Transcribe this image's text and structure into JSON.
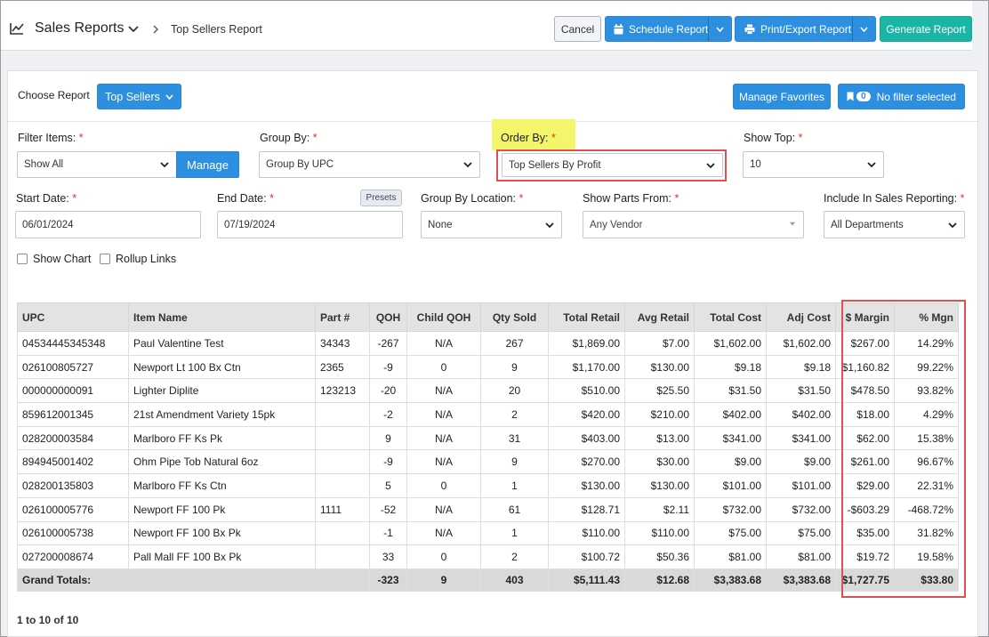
{
  "header": {
    "app_title": "Sales Reports",
    "breadcrumb": "Top Sellers Report",
    "cancel_label": "Cancel",
    "schedule_label": "Schedule Report",
    "print_label": "Print/Export Report",
    "generate_label": "Generate Report"
  },
  "report_bar": {
    "choose_label": "Choose Report",
    "choose_value": "Top Sellers",
    "manage_favorites_label": "Manage Favorites",
    "filter_count": "0",
    "filter_label": "No filter selected"
  },
  "filters": {
    "filter_items": {
      "label": "Filter Items:",
      "value": "Show All",
      "manage_label": "Manage"
    },
    "group_by": {
      "label": "Group By:",
      "value": "Group By UPC"
    },
    "order_by": {
      "label": "Order By:",
      "value": "Top Sellers By Profit"
    },
    "show_top": {
      "label": "Show Top:",
      "value": "10"
    },
    "start_date": {
      "label": "Start Date:",
      "value": "06/01/2024"
    },
    "end_date": {
      "label": "End Date:",
      "value": "07/19/2024",
      "presets_label": "Presets"
    },
    "group_by_location": {
      "label": "Group By Location:",
      "value": "None"
    },
    "show_parts_from": {
      "label": "Show Parts From:",
      "value": "Any Vendor"
    },
    "include_sales": {
      "label": "Include In Sales Reporting:",
      "value": "All Departments"
    },
    "required_mark": "*",
    "show_chart_label": "Show Chart",
    "rollup_links_label": "Rollup Links"
  },
  "table": {
    "columns": [
      "UPC",
      "Item Name",
      "Part #",
      "QOH",
      "Child QOH",
      "Qty Sold",
      "Total Retail",
      "Avg Retail",
      "Total Cost",
      "Adj Cost",
      "$ Margin",
      "% Mgn"
    ],
    "rows": [
      [
        "04534445345348",
        "Paul Valentine Test",
        "34343",
        "-267",
        "N/A",
        "267",
        "$1,869.00",
        "$7.00",
        "$1,602.00",
        "$1,602.00",
        "$267.00",
        "14.29%"
      ],
      [
        "026100805727",
        "Newport Lt 100 Bx Ctn",
        "2365",
        "-9",
        "0",
        "9",
        "$1,170.00",
        "$130.00",
        "$9.18",
        "$9.18",
        "$1,160.82",
        "99.22%"
      ],
      [
        "000000000091",
        "Lighter Diplite",
        "123213",
        "-20",
        "N/A",
        "20",
        "$510.00",
        "$25.50",
        "$31.50",
        "$31.50",
        "$478.50",
        "93.82%"
      ],
      [
        "859612001345",
        "21st Amendment Variety 15pk",
        "",
        "-2",
        "N/A",
        "2",
        "$420.00",
        "$210.00",
        "$402.00",
        "$402.00",
        "$18.00",
        "4.29%"
      ],
      [
        "028200003584",
        "Marlboro FF Ks Pk",
        "",
        "9",
        "N/A",
        "31",
        "$403.00",
        "$13.00",
        "$341.00",
        "$341.00",
        "$62.00",
        "15.38%"
      ],
      [
        "894945001402",
        "Ohm Pipe Tob Natural 6oz",
        "",
        "-9",
        "N/A",
        "9",
        "$270.00",
        "$30.00",
        "$9.00",
        "$9.00",
        "$261.00",
        "96.67%"
      ],
      [
        "028200135803",
        "Marlboro FF Ks Ctn",
        "",
        "5",
        "0",
        "1",
        "$130.00",
        "$130.00",
        "$101.00",
        "$101.00",
        "$29.00",
        "22.31%"
      ],
      [
        "026100005776",
        "Newport FF 100 Pk",
        "1111",
        "-52",
        "N/A",
        "61",
        "$128.71",
        "$2.11",
        "$732.00",
        "$732.00",
        "-$603.29",
        "-468.72%"
      ],
      [
        "026100005738",
        "Newport FF 100 Bx Pk",
        "",
        "-1",
        "N/A",
        "1",
        "$110.00",
        "$110.00",
        "$75.00",
        "$75.00",
        "$35.00",
        "31.82%"
      ],
      [
        "027200008674",
        "Pall Mall FF 100 Bx Pk",
        "",
        "33",
        "0",
        "2",
        "$100.72",
        "$50.36",
        "$81.00",
        "$81.00",
        "$19.72",
        "19.58%"
      ]
    ],
    "totals": [
      "Grand Totals:",
      "-323",
      "9",
      "403",
      "$5,111.43",
      "$12.68",
      "$3,383.68",
      "$3,383.68",
      "$1,727.75",
      "$33.80"
    ]
  },
  "pager": "1 to 10 of 10"
}
